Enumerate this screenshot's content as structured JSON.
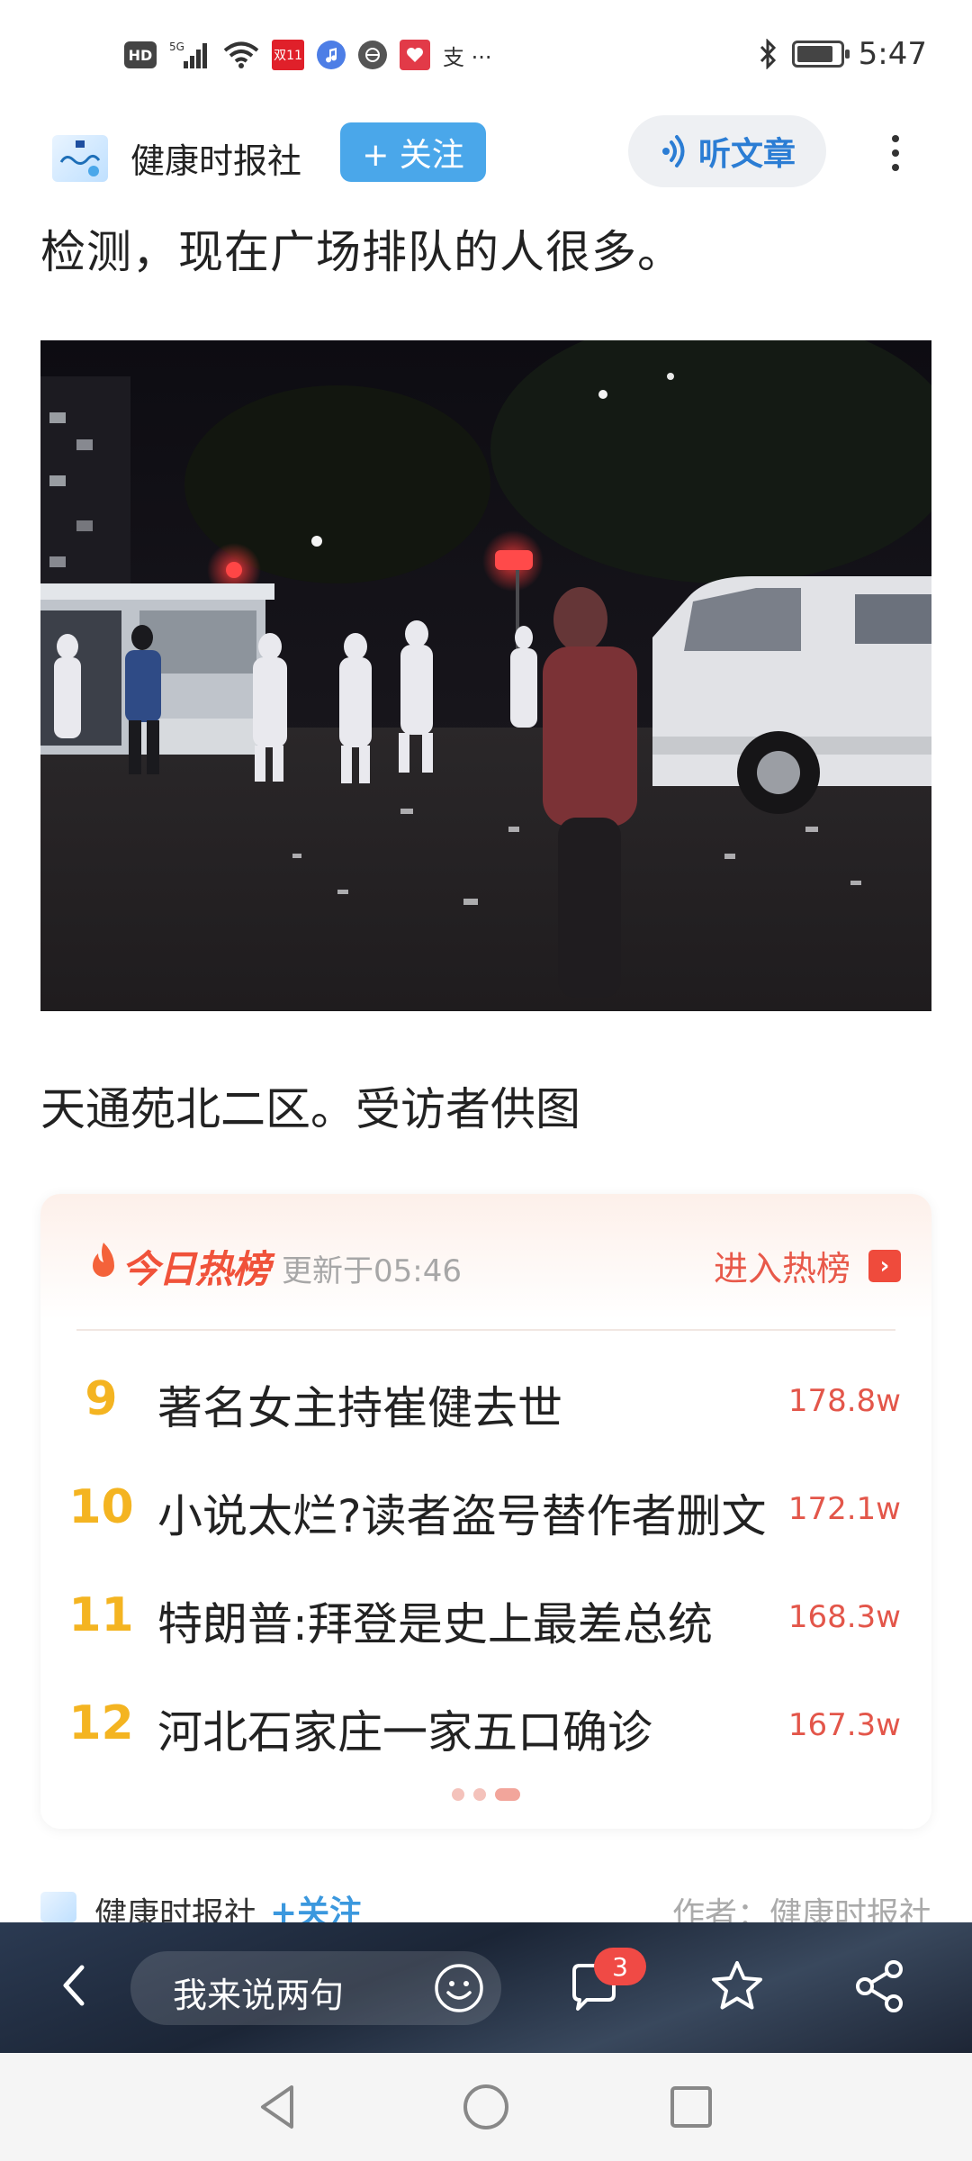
{
  "status_bar": {
    "hd": "HD",
    "signal": "5G",
    "app_badge": "双11",
    "extra": "支 ···",
    "time": "5:47",
    "battery_level": 0.85
  },
  "header": {
    "account_name": "健康时报社",
    "follow_label": "+ 关注",
    "listen_label": "听文章"
  },
  "article": {
    "paragraph_tail": "检测，现在广场排队的人很多。",
    "caption": "天通苑北二区。受访者供图"
  },
  "hot_list": {
    "title": "今日热榜",
    "updated": "更新于05:46",
    "enter_label": "进入热榜",
    "items": [
      {
        "rank": "9",
        "text": "著名女主持崔健去世",
        "count": "178.8w"
      },
      {
        "rank": "10",
        "text": "小说太烂?读者盗号替作者删文",
        "count": "172.1w"
      },
      {
        "rank": "11",
        "text": "特朗普:拜登是史上最差总统",
        "count": "168.3w"
      },
      {
        "rank": "12",
        "text": "河北石家庄一家五口确诊",
        "count": "167.3w"
      }
    ],
    "page_index": 3,
    "page_count": 3
  },
  "author_row": {
    "account_name": "健康时报社",
    "follow_label": "+关注",
    "author_text": "作者：健康时报社"
  },
  "toolbar": {
    "comment_placeholder": "我来说两句",
    "comment_count": "3"
  },
  "colors": {
    "follow_blue": "#4aa7ea",
    "hot_red": "#f0523a",
    "rank_gold": "#f4b421"
  }
}
